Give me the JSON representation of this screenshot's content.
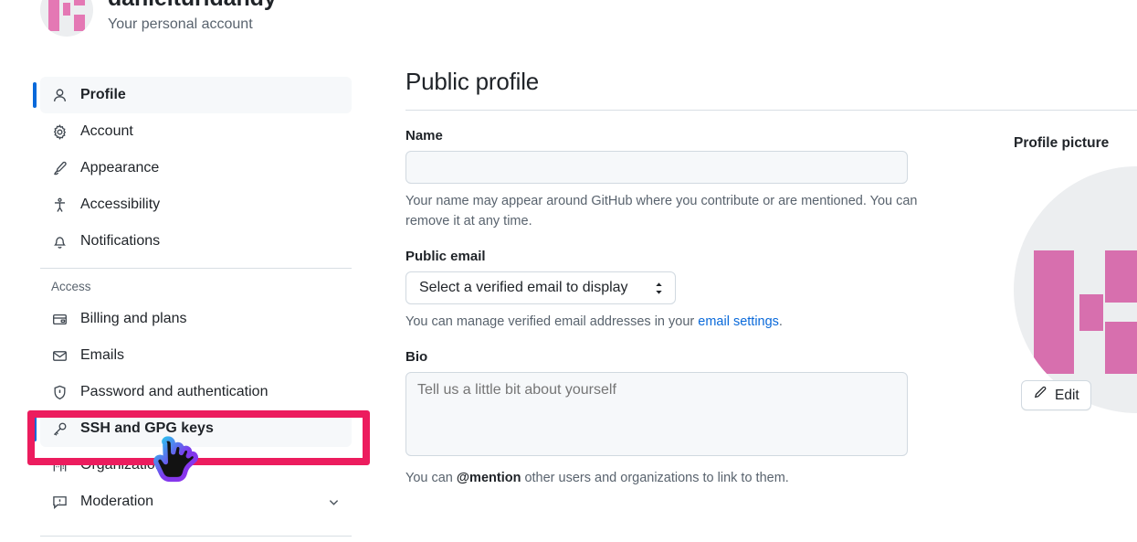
{
  "account": {
    "name": "danielturidandy",
    "subtitle": "Your personal account",
    "avatar_icon": "user-identicon-avatar"
  },
  "sidebar": {
    "primary_items": [
      {
        "label": "Profile",
        "icon": "person-icon",
        "active": true
      },
      {
        "label": "Account",
        "icon": "gear-icon",
        "active": false
      },
      {
        "label": "Appearance",
        "icon": "paintbrush-icon",
        "active": false
      },
      {
        "label": "Accessibility",
        "icon": "accessibility-icon",
        "active": false
      },
      {
        "label": "Notifications",
        "icon": "bell-icon",
        "active": false
      }
    ],
    "section_title": "Access",
    "access_items": [
      {
        "label": "Billing and plans",
        "icon": "credit-card-icon",
        "active": false,
        "expandable": false
      },
      {
        "label": "Emails",
        "icon": "mail-icon",
        "active": false,
        "expandable": false
      },
      {
        "label": "Password and authentication",
        "icon": "shield-lock-icon",
        "active": false,
        "expandable": false
      },
      {
        "label": "SSH and GPG keys",
        "icon": "key-icon",
        "active": true,
        "expandable": false
      },
      {
        "label": "Organizations",
        "icon": "organization-icon",
        "active": false,
        "expandable": false
      },
      {
        "label": "Moderation",
        "icon": "report-icon",
        "active": false,
        "expandable": true
      }
    ]
  },
  "main": {
    "title": "Public profile",
    "name_field": {
      "label": "Name",
      "value": "",
      "placeholder": "",
      "help": "Your name may appear around GitHub where you contribute or are mentioned. You can remove it at any time."
    },
    "public_email": {
      "label": "Public email",
      "selected_option": "Select a verified email to display",
      "options": [
        "Select a verified email to display"
      ],
      "help_prefix": "You can manage verified email addresses in your ",
      "help_link": "email settings",
      "help_suffix": "."
    },
    "bio": {
      "label": "Bio",
      "value": "",
      "placeholder": "Tell us a little bit about yourself",
      "help_prefix": "You can ",
      "help_strong": "@mention",
      "help_suffix": " other users and organizations to link to them."
    }
  },
  "profile_picture": {
    "label": "Profile picture",
    "edit_label": "Edit",
    "edit_icon": "pencil-icon",
    "image_icon": "identicon-avatar-large"
  },
  "annotations": {
    "highlight_target": "SSH and GPG keys",
    "highlight_color": "#ec1c5e",
    "cursor_icon": "pointing-hand-cursor"
  },
  "colors": {
    "accent_blue": "#0969da",
    "link_blue": "#0969da",
    "avatar_pink": "#d76fae",
    "border": "#d1d9e0",
    "muted_text": "#59636e",
    "active_bg": "#f6f8fa"
  }
}
